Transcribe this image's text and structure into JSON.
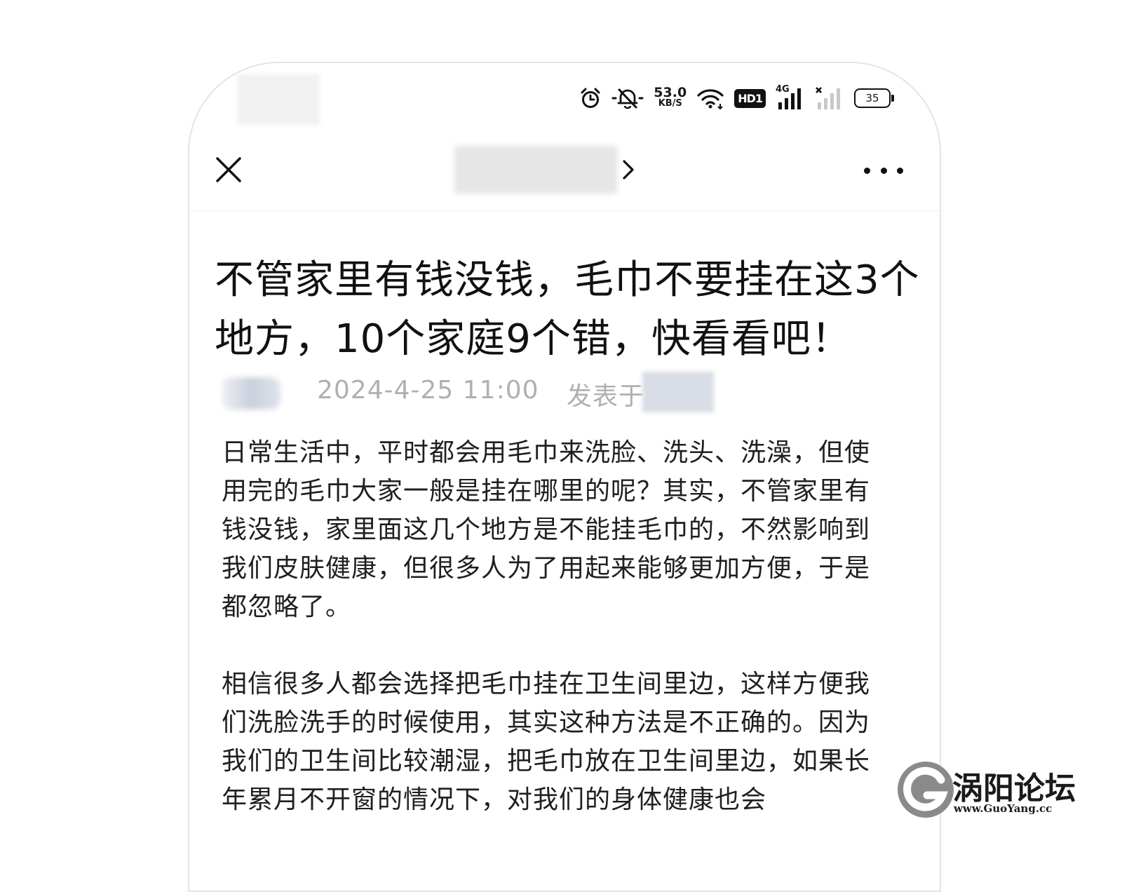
{
  "status_bar": {
    "net_speed_value": "53.0",
    "net_speed_unit": "KB/S",
    "hd_badge": "HD1",
    "network_type": "4G",
    "battery_level": "35",
    "icons": [
      "alarm-icon",
      "mute-bell-icon",
      "wifi-icon",
      "hd-icon",
      "signal-4g-icon",
      "signal-no-service-icon",
      "battery-icon"
    ]
  },
  "nav": {
    "icons": [
      "close-icon",
      "chevron-right-icon",
      "more-icon"
    ]
  },
  "article": {
    "title": "不管家里有钱没钱，毛巾不要挂在这3个地方，10个家庭9个错，快看看吧！",
    "date": "2024-4-25 11:00",
    "published_in": "发表于",
    "paragraphs": [
      "日常生活中，平时都会用毛巾来洗脸、洗头、洗澡，但使用完的毛巾大家一般是挂在哪里的呢？其实，不管家里有钱没钱，家里面这几个地方是不能挂毛巾的，不然影响到我们皮肤健康，但很多人为了用起来能够更加方便，于是都忽略了。",
      "相信很多人都会选择把毛巾挂在卫生间里边，这样方便我们洗脸洗手的时候使用，其实这种方法是不正确的。因为我们的卫生间比较潮湿，把毛巾放在卫生间里边，如果长年累月不开窗的情况下，对我们的身体健康也会"
    ]
  },
  "watermark": {
    "name": "涡阳论坛",
    "url": "www.GuoYang.cc"
  }
}
